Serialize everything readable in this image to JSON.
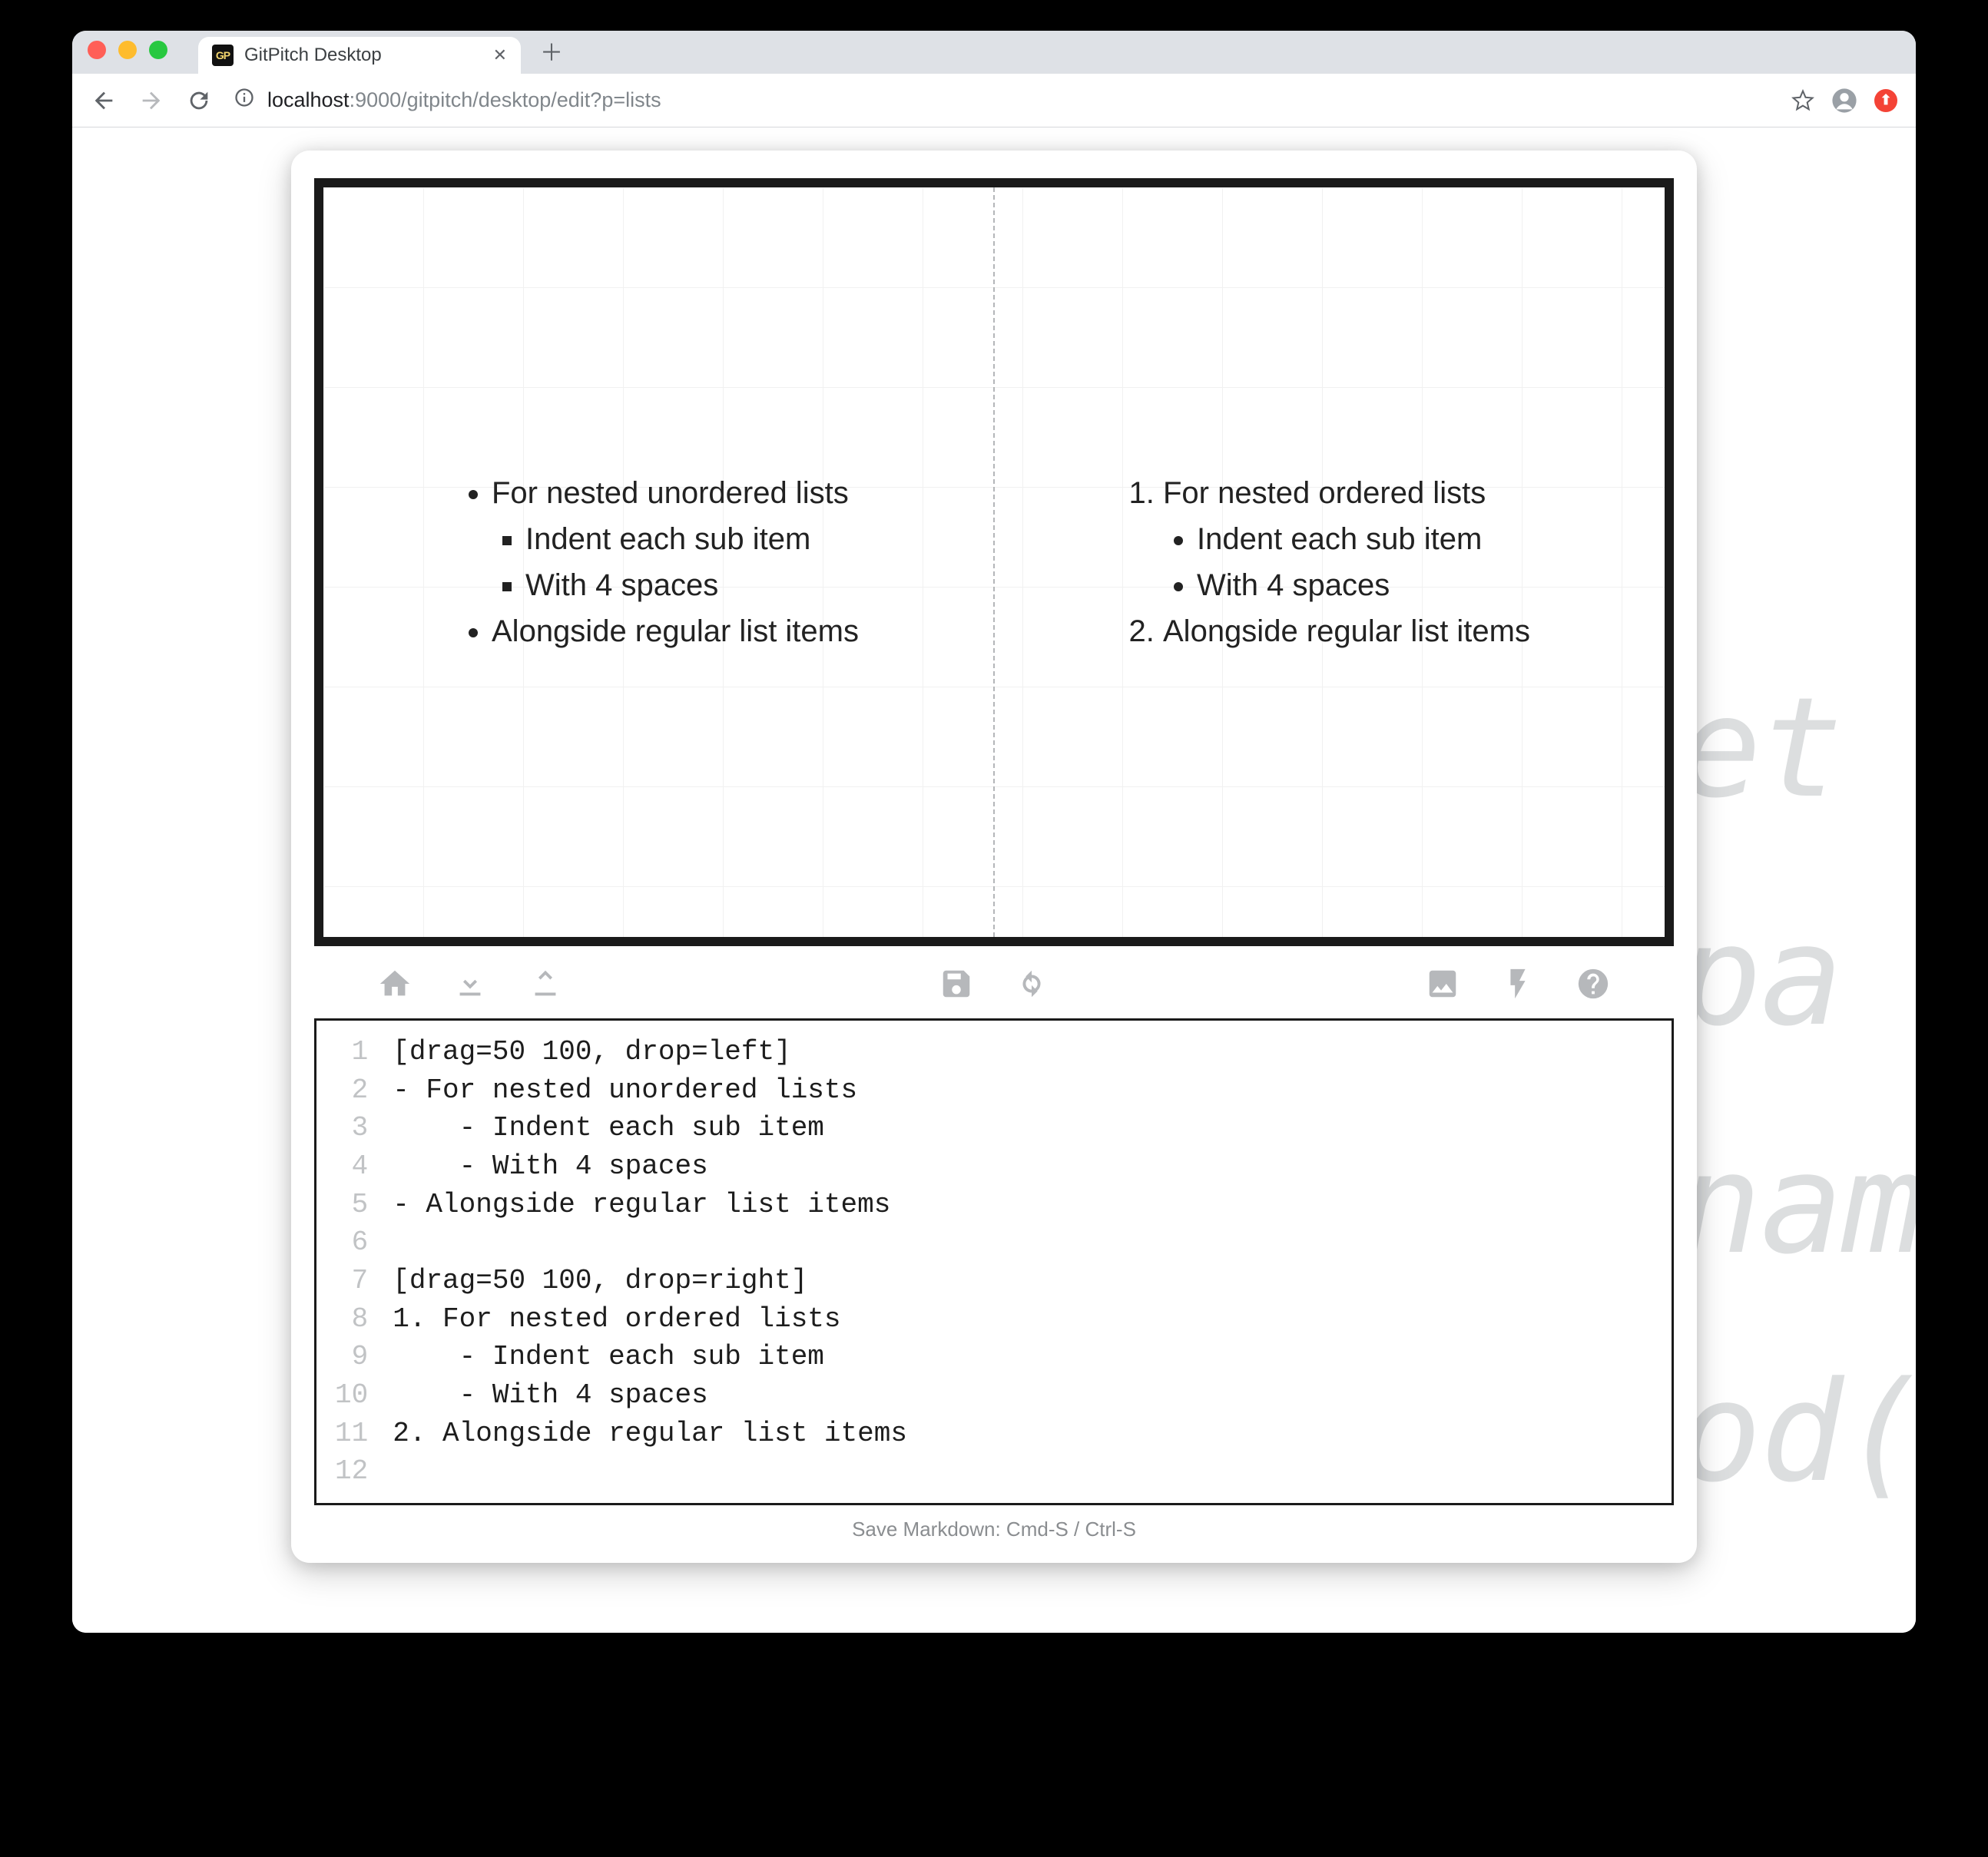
{
  "tab": {
    "title": "GitPitch Desktop",
    "favicon_text": "GP"
  },
  "url": {
    "host_prefix": "localhost",
    "host_suffix": ":9000",
    "path": "/gitpitch/desktop/edit?p=lists"
  },
  "bgcode": {
    "l1": "et",
    "l2": "pa",
    "l3": "nam",
    "l4": "od("
  },
  "slide": {
    "left": {
      "items": [
        "For nested unordered lists",
        "Alongside regular list items"
      ],
      "subitems": [
        "Indent each sub item",
        "With 4 spaces"
      ]
    },
    "right": {
      "items": [
        "For nested ordered lists",
        "Alongside regular list items"
      ],
      "subitems": [
        "Indent each sub item",
        "With 4 spaces"
      ]
    }
  },
  "editor": {
    "gutter": "1\n2\n3\n4\n5\n6\n7\n8\n9\n10\n11\n12",
    "code": "[drag=50 100, drop=left]\n- For nested unordered lists\n    - Indent each sub item\n    - With 4 spaces\n- Alongside regular list items\n\n[drag=50 100, drop=right]\n1. For nested ordered lists\n    - Indent each sub item\n    - With 4 spaces\n2. Alongside regular list items\n"
  },
  "footer": {
    "hint": "Save Markdown: Cmd-S / Ctrl-S"
  }
}
